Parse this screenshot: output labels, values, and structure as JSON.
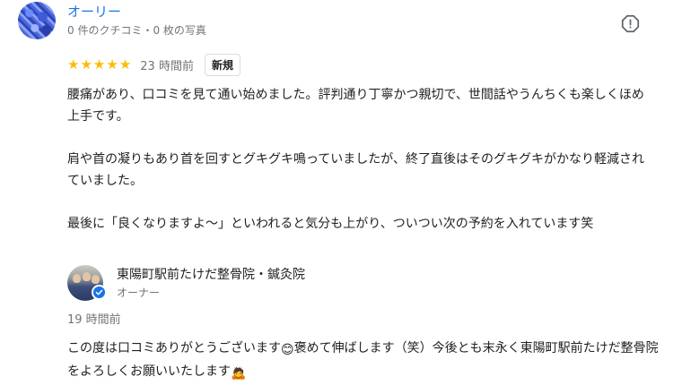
{
  "review": {
    "author_name": "オーリー",
    "author_meta": "0 件のクチコミ・0 枚の写真",
    "rating": 5,
    "stars": [
      "★",
      "★",
      "★",
      "★",
      "★"
    ],
    "time": "23 時間前",
    "badge": "新規",
    "paragraphs": [
      "腰痛があり、口コミを見て通い始めました。評判通り丁寧かつ親切で、世間話やうんちくも楽しくほめ上手です。",
      "肩や首の凝りもあり首を回すとグキグキ鳴っていましたが、終了直後はそのグキグキがかなり軽減されていました。",
      "最後に「良くなりますよ〜」といわれると気分も上がり、ついつい次の予約を入れています笑"
    ]
  },
  "reply": {
    "owner_name": "東陽町駅前たけだ整骨院・鍼灸院",
    "owner_role": "オーナー",
    "time": "19 時間前",
    "text_part1": "この度は口コミありがとうございます",
    "emoji1": "😊",
    "text_part2": "褒めて伸ばします（笑）今後とも末永く東陽町駅前たけだ整骨院をよろしくお願いいたします",
    "emoji2": "🙇"
  },
  "colors": {
    "author_link": "#1a73e8",
    "star": "#fbbc04",
    "muted": "#70757a",
    "text": "#202124"
  },
  "icons": {
    "report": "report-icon",
    "verified": "verified-check-icon"
  }
}
